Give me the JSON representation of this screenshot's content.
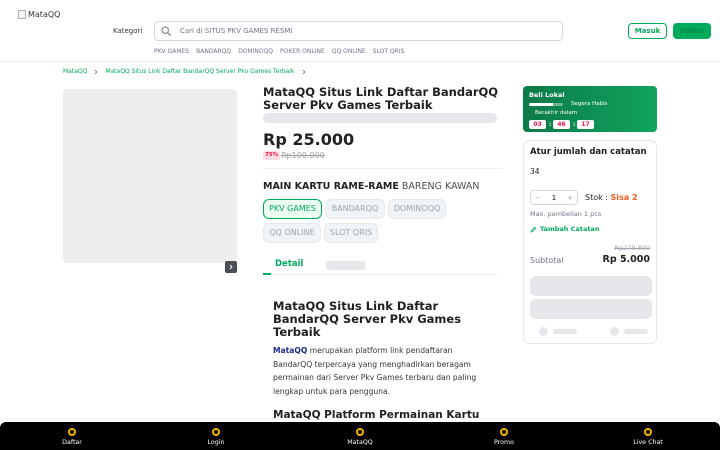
{
  "header": {
    "logo_alt": "MataQQ",
    "kategori_label": "Kategori",
    "search_placeholder": "Cari di SITUS PKV GAMES RESMI",
    "login_label": "Masuk",
    "register_label": "Daftar",
    "nav_links": [
      "PKV GAMES",
      "BANDARQQ",
      "DOMINOQQ",
      "POKER ONLINE",
      "QQ ONLINE",
      "SLOT QRIS"
    ]
  },
  "breadcrumb": [
    "MataQQ",
    "MataQQ Situs Link Daftar BandarQQ Server Pkv Games Terbaik"
  ],
  "product": {
    "title": "MataQQ Situs Link Daftar BandarQQ Server Pkv Games Terbaik",
    "price": "Rp 25.000",
    "discount": "75%",
    "old_price": "Rp100.000"
  },
  "variant": {
    "title_bold": "MAIN KARTU RAME-RAME",
    "title_light": "BARENG KAWAN",
    "options": [
      "PKV GAMES",
      "BANDARQQ",
      "DOMINOQQ",
      "QQ ONLINE",
      "SLOT QRIS"
    ],
    "selected": "PKV GAMES"
  },
  "tabs": {
    "detail_label": "Detail"
  },
  "description": {
    "title": "MataQQ Situs Link Daftar BandarQQ Server Pkv Games Terbaik",
    "brand": "MataQQ",
    "text": " merupakan platform link pendaftaran BandarQQ terpercaya yang menghadirkan beragam permainan dari Server Pkv Games terbaru dan paling lengkap untuk para pengguna.",
    "subtitle": "MataQQ Platform Permainan Kartu"
  },
  "promo": {
    "title": "Beli Lokal",
    "stock_status": "Segera Habis",
    "stock_fill": 0.7,
    "ends_label": "Berakhir dalam",
    "hours": "03",
    "minutes": "46",
    "seconds": "17"
  },
  "order": {
    "title": "Atur jumlah dan catatan",
    "variant_value": "34",
    "quantity": "1",
    "minus": "−",
    "plus": "+",
    "stock_label": "Stok : ",
    "stock_value": "Sisa 2",
    "max_buy": "Max. pembelian 1 pcs",
    "add_note": "Tambah Catatan",
    "subtotal_old": "Rp279.800",
    "subtotal_label": "Subtotal",
    "subtotal_value": "Rp 5.000"
  },
  "bottom_nav": [
    "Daftar",
    "Login",
    "MataQQ",
    "Promo",
    "Live Chat"
  ],
  "colors": {
    "accent": "#00aa5b",
    "discount": "#ef144a",
    "stock": "#fa591d",
    "bottom_nav_bg": "#000000"
  }
}
